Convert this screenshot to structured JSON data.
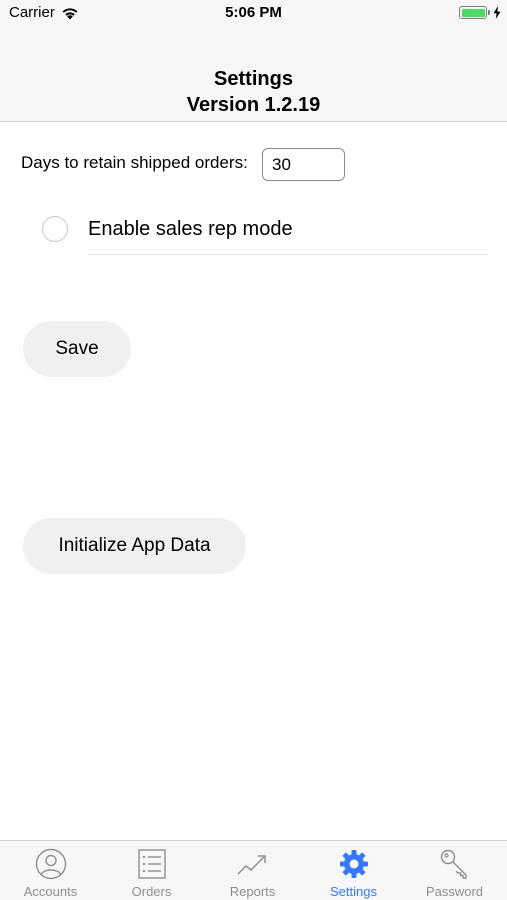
{
  "status_bar": {
    "carrier": "Carrier",
    "time": "5:06 PM",
    "battery_level": 1.0
  },
  "nav": {
    "title": "Settings",
    "subtitle": "Version 1.2.19"
  },
  "settings": {
    "days_label": "Days to retain shipped orders:",
    "days_value": "30",
    "sales_rep_label": "Enable sales rep mode",
    "sales_rep_enabled": false
  },
  "buttons": {
    "save": "Save",
    "init": "Initialize App Data"
  },
  "tabs": [
    {
      "label": "Accounts",
      "icon": "person-circle-icon",
      "active": false
    },
    {
      "label": "Orders",
      "icon": "list-icon",
      "active": false
    },
    {
      "label": "Reports",
      "icon": "trend-chart-icon",
      "active": false
    },
    {
      "label": "Settings",
      "icon": "gear-icon",
      "active": true
    },
    {
      "label": "Password",
      "icon": "key-icon",
      "active": false
    }
  ],
  "colors": {
    "accent": "#3478f6",
    "inactive": "#8e8e93",
    "battery": "#4cd964",
    "bar_background": "#f7f7f7",
    "button_background": "#f0f0f0"
  }
}
